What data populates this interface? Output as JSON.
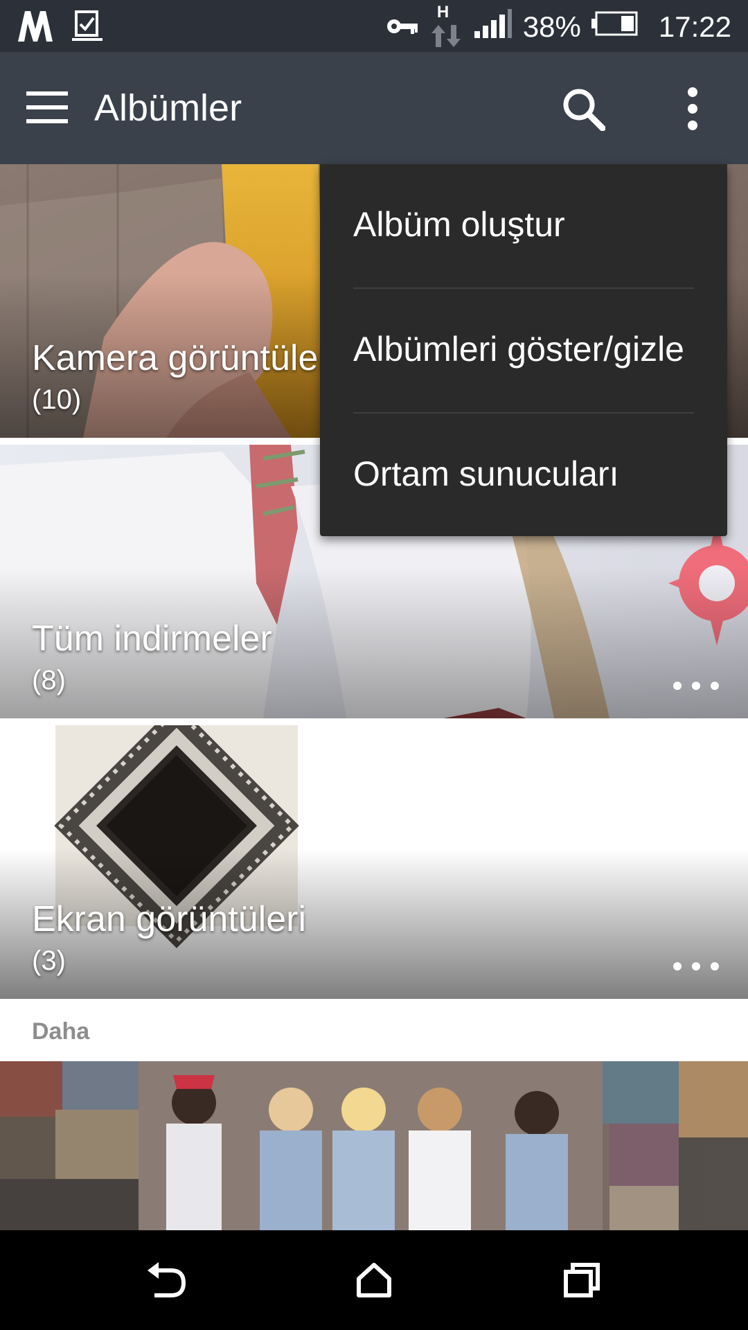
{
  "status_bar": {
    "battery_percent": "38%",
    "time": "17:22",
    "network_type": "H"
  },
  "app_bar": {
    "title": "Albümler",
    "icons": [
      "menu-icon",
      "search-icon",
      "overflow-menu-icon"
    ]
  },
  "albums": [
    {
      "name": "Kamera görüntüleri",
      "count": "(10)"
    },
    {
      "name": "Tüm indirmeler",
      "count": "(8)"
    },
    {
      "name": "Ekran görüntüleri",
      "count": "(3)"
    }
  ],
  "more_section": {
    "label": "Daha"
  },
  "overflow_menu": {
    "items": [
      "Albüm oluştur",
      "Albümleri göster/gizle",
      "Ortam sunucuları"
    ]
  },
  "nav_bar": {
    "icons": [
      "back-icon",
      "home-icon",
      "recents-icon"
    ]
  },
  "colors": {
    "status_bar": "#2c3139",
    "app_bar": "#3b414b",
    "menu_bg": "#2a2a2a"
  }
}
